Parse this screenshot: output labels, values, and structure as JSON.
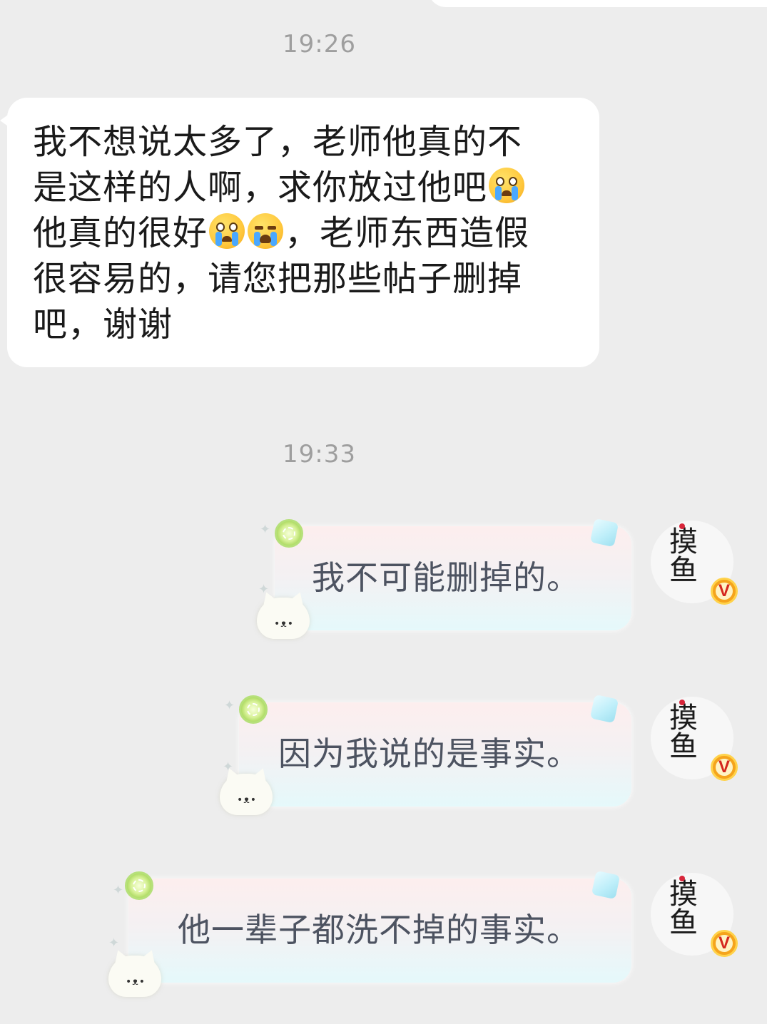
{
  "timestamps": [
    "19:26",
    "19:33"
  ],
  "incoming": {
    "lines": [
      {
        "text": "我不想说太多了，老师他真的不",
        "emojis_after": []
      },
      {
        "text": "是这样的人啊，求你放过他吧",
        "emojis_after": [
          "loudly-crying-emoji"
        ]
      },
      {
        "text_before": "他真的很好",
        "text_after": "，老师东西造假",
        "emojis_between": [
          "loudly-crying-emoji",
          "crying-emoji"
        ]
      },
      {
        "text": "很容易的，请您把那些帖子删掉",
        "emojis_after": []
      },
      {
        "text": "吧，谢谢",
        "emojis_after": []
      }
    ]
  },
  "outgoing": [
    {
      "text": "我不可能删掉的。"
    },
    {
      "text": "因为我说的是事实。"
    },
    {
      "text": "他一辈子都洗不掉的事实。"
    }
  ],
  "avatar": {
    "calligraphy": "摸鱼",
    "badge": "V",
    "badge_color": "#f5a41c"
  },
  "colors": {
    "background": "#ededed",
    "incoming_bubble": "#ffffff",
    "incoming_text": "#1a1a1a",
    "outgoing_text": "#4d5361",
    "timestamp": "#9e9e9e"
  }
}
